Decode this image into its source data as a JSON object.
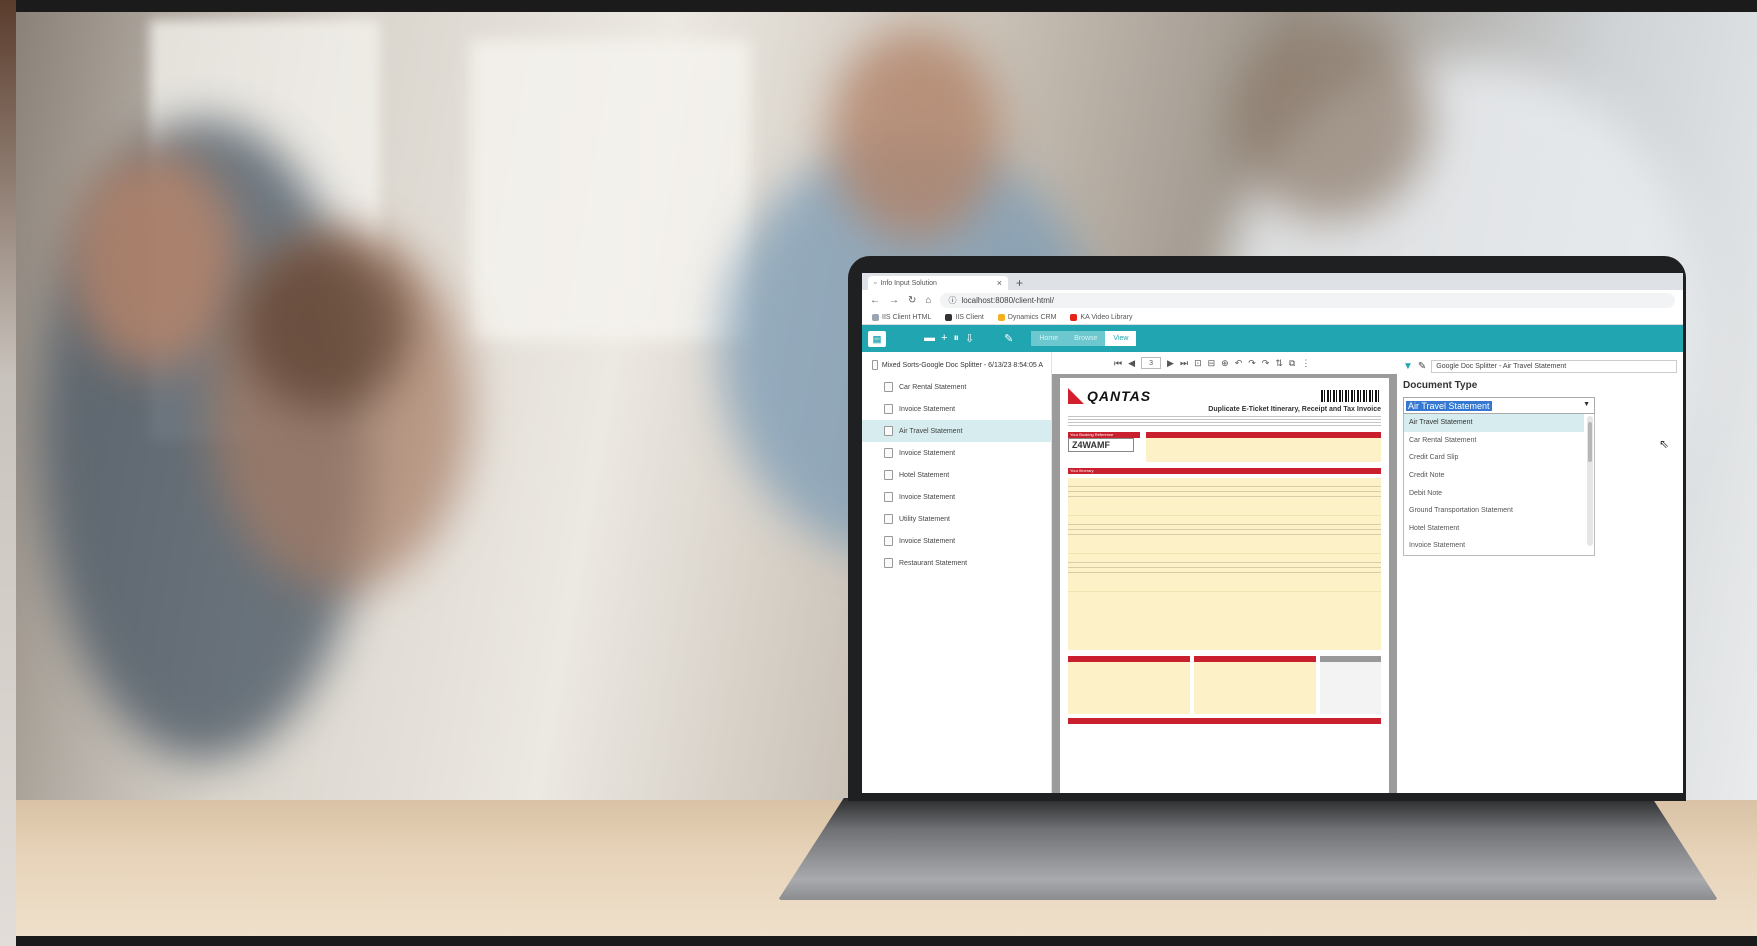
{
  "browser": {
    "tab_title": "Info Input Solution",
    "tab_close": "×",
    "new_tab": "+",
    "url": "localhost:8080/client-html/",
    "bookmarks": [
      {
        "label": "IIS Client HTML",
        "icon": "page-icon",
        "color": "#9aa6b2"
      },
      {
        "label": "IIS Client",
        "icon": "globe-icon",
        "color": "#333333"
      },
      {
        "label": "Dynamics CRM",
        "icon": "windows-icon",
        "color": "#f2b01e"
      },
      {
        "label": "KA Video Library",
        "icon": "youtube-icon",
        "color": "#e62117"
      }
    ]
  },
  "app": {
    "accent": "#21a6b1",
    "menu_tabs": [
      "Home",
      "Browse",
      "View"
    ],
    "active_tab": "View"
  },
  "tree": {
    "header": "Mixed Sorts-Google Doc Splitter - 6/13/23 8:54:05 A",
    "items": [
      {
        "label": "Car Rental Statement",
        "selected": false
      },
      {
        "label": "Invoice Statement",
        "selected": false
      },
      {
        "label": "Air Travel Statement",
        "selected": true
      },
      {
        "label": "Invoice Statement",
        "selected": false
      },
      {
        "label": "Hotel Statement",
        "selected": false
      },
      {
        "label": "Invoice Statement",
        "selected": false
      },
      {
        "label": "Utility Statement",
        "selected": false
      },
      {
        "label": "Invoice Statement",
        "selected": false
      },
      {
        "label": "Restaurant Statement",
        "selected": false
      }
    ]
  },
  "viewer": {
    "page_number": "3",
    "document": {
      "brand": "QANTAS",
      "title": "Duplicate E-Ticket Itinerary, Receipt and Tax Invoice",
      "booking_ref_label": "Your Booking Reference",
      "booking_ref": "Z4WAMF",
      "itinerary_label": "Your Itinerary"
    }
  },
  "side_panel": {
    "breadcrumb": "Google Doc Splitter - Air Travel Statement",
    "doc_type_label": "Document Type",
    "selected_value": "Air Travel Statement",
    "options": [
      "Air Travel Statement",
      "Car Rental Statement",
      "Credit Card Slip",
      "Credit Note",
      "Debit Note",
      "Ground Transportation Statement",
      "Hotel Statement",
      "Invoice Statement"
    ]
  }
}
